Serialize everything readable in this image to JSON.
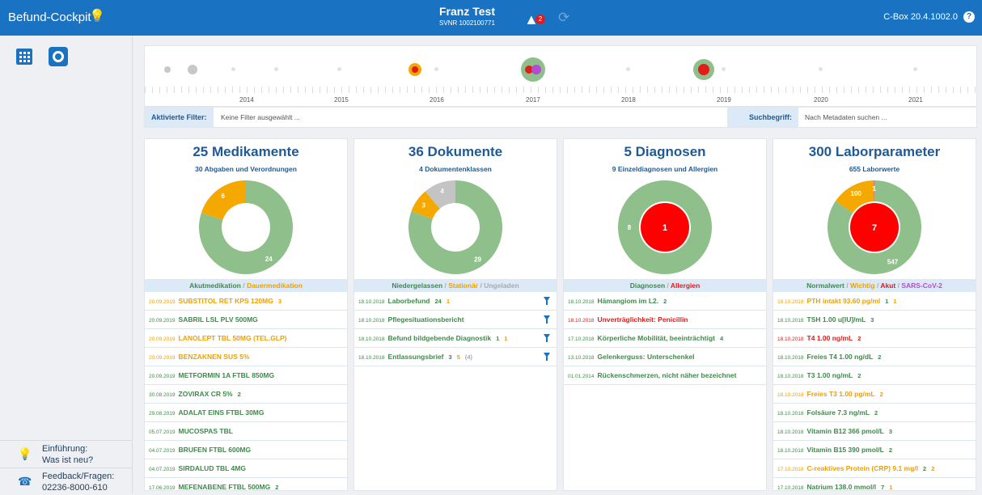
{
  "header": {
    "app_title": "Befund-Cockpit",
    "patient_name": "Franz Test",
    "patient_svnr": "SVNR 1002100771",
    "warning_count": "2",
    "version": "C-Box 20.4.1002.0",
    "help_label": "?"
  },
  "sidebar": {
    "intro_line1": "Einführung:",
    "intro_line2": "Was ist neu?",
    "feedback_line1": "Feedback/Fragen:",
    "feedback_line2": "02236-8000-610"
  },
  "timeline": {
    "years": [
      "2014",
      "2015",
      "2016",
      "2017",
      "2018",
      "2019",
      "2020",
      "2021"
    ]
  },
  "filters": {
    "active_label": "Aktivierte Filter:",
    "active_value": "Keine Filter ausgewählt ...",
    "search_label": "Suchbegriff:",
    "search_placeholder": "Nach Metadaten suchen ..."
  },
  "panels": [
    {
      "title": "25 Medikamente",
      "subtitle": "30 Abgaben und Verordnungen",
      "legend": [
        {
          "t": "Akutmedikation",
          "c": "g"
        },
        {
          "t": "Dauermedikation",
          "c": "o"
        }
      ],
      "donut": {
        "slices": [
          {
            "v": 24,
            "color": "#8fbf8a",
            "label": "24"
          },
          {
            "v": 6,
            "color": "#f5a800",
            "label": "6"
          }
        ]
      },
      "rows": [
        {
          "d": "20.09.2019",
          "t": "SUBSTITOL RET KPS 120MG",
          "c": "o",
          "n": [
            {
              "v": "3",
              "c": "o"
            }
          ]
        },
        {
          "d": "20.09.2019",
          "t": "SABRIL LSL PLV 500MG",
          "c": "g",
          "n": []
        },
        {
          "d": "20.09.2019",
          "t": "LANOLEPT TBL 50MG (TEL.GLP)",
          "c": "o",
          "n": []
        },
        {
          "d": "20.09.2019",
          "t": "BENZAKNEN SUS 5%",
          "c": "o",
          "n": []
        },
        {
          "d": "20.09.2019",
          "t": "METFORMIN 1A FTBL 850MG",
          "c": "g",
          "n": []
        },
        {
          "d": "30.08.2019",
          "t": "ZOVIRAX CR 5%",
          "c": "g",
          "n": [
            {
              "v": "2",
              "c": "g"
            }
          ]
        },
        {
          "d": "29.08.2019",
          "t": "ADALAT EINS FTBL 30MG",
          "c": "g",
          "n": []
        },
        {
          "d": "05.07.2019",
          "t": "MUCOSPAS TBL",
          "c": "g",
          "n": []
        },
        {
          "d": "04.07.2019",
          "t": "BRUFEN FTBL 600MG",
          "c": "g",
          "n": []
        },
        {
          "d": "04.07.2019",
          "t": "SIRDALUD TBL 4MG",
          "c": "g",
          "n": []
        },
        {
          "d": "17.06.2019",
          "t": "MEFENABENE FTBL 500MG",
          "c": "g",
          "n": [
            {
              "v": "2",
              "c": "g"
            }
          ]
        }
      ]
    },
    {
      "title": "36 Dokumente",
      "subtitle": "4 Dokumentenklassen",
      "legend": [
        {
          "t": "Niedergelassen",
          "c": "g"
        },
        {
          "t": "Stationär",
          "c": "o"
        },
        {
          "t": "Ungeladen",
          "c": "gr"
        }
      ],
      "donut": {
        "slices": [
          {
            "v": 29,
            "color": "#8fbf8a",
            "label": "29"
          },
          {
            "v": 3,
            "color": "#f5a800",
            "label": "3"
          },
          {
            "v": 4,
            "color": "#c4c4c4",
            "label": "4"
          }
        ]
      },
      "rows": [
        {
          "d": "18.10.2018",
          "t": "Laborbefund",
          "c": "g",
          "n": [
            {
              "v": "24",
              "c": "g"
            },
            {
              "v": "1",
              "c": "o"
            }
          ],
          "filter": true
        },
        {
          "d": "18.10.2018",
          "t": "Pflegesituationsbericht",
          "c": "g",
          "n": [],
          "filter": true
        },
        {
          "d": "18.10.2018",
          "t": "Befund bildgebende Diagnostik",
          "c": "g",
          "n": [
            {
              "v": "1",
              "c": "g"
            },
            {
              "v": "1",
              "c": "o"
            }
          ],
          "filter": true
        },
        {
          "d": "18.10.2018",
          "t": "Entlassungsbrief",
          "c": "g",
          "n": [
            {
              "v": "3",
              "c": "g"
            },
            {
              "v": "5",
              "c": "o"
            },
            {
              "v": "(4)",
              "c": "gr"
            }
          ],
          "filter": true
        }
      ]
    },
    {
      "title": "5 Diagnosen",
      "subtitle": "9 Einzeldiagnosen und Allergien",
      "legend": [
        {
          "t": "Diagnosen",
          "c": "g"
        },
        {
          "t": "Allergien",
          "c": "r"
        }
      ],
      "donut": {
        "slices": [
          {
            "v": 8,
            "color": "#8fbf8a",
            "label": "8"
          }
        ],
        "center": {
          "value": "1",
          "color": "#ff0000"
        }
      },
      "rows": [
        {
          "d": "18.10.2018",
          "t": "Hämangiom im L2.",
          "c": "g",
          "n": [
            {
              "v": "2",
              "c": "g"
            }
          ]
        },
        {
          "d": "18.10.2018",
          "t": "Unverträglichkeit: Penicillin",
          "c": "r",
          "n": []
        },
        {
          "d": "17.10.2018",
          "t": "Körperliche Mobilität, beeinträchtigt",
          "c": "g",
          "n": [
            {
              "v": "4",
              "c": "g"
            }
          ]
        },
        {
          "d": "13.10.2018",
          "t": "Gelenkerguss: Unterschenkel",
          "c": "g",
          "n": []
        },
        {
          "d": "01.01.2014",
          "t": "Rückenschmerzen, nicht näher bezeichnet",
          "c": "g",
          "n": []
        }
      ]
    },
    {
      "title": "300 Laborparameter",
      "subtitle": "655 Laborwerte",
      "legend": [
        {
          "t": "Normalwert",
          "c": "g"
        },
        {
          "t": "Wichtig",
          "c": "o"
        },
        {
          "t": "Akut",
          "c": "r"
        },
        {
          "t": "SARS-CoV-2",
          "c": "p"
        }
      ],
      "donut": {
        "slices": [
          {
            "v": 547,
            "color": "#8fbf8a",
            "label": "547"
          },
          {
            "v": 100,
            "color": "#f5a800",
            "label": "100"
          },
          {
            "v": 1,
            "color": "#b24dd1",
            "label": "1"
          }
        ],
        "center": {
          "value": "7",
          "color": "#ff0000"
        }
      },
      "rows": [
        {
          "d": "18.10.2018",
          "t": "PTH intakt 93.60 pg/ml",
          "c": "o",
          "n": [
            {
              "v": "1",
              "c": "g"
            },
            {
              "v": "1",
              "c": "o"
            }
          ]
        },
        {
          "d": "18.10.2018",
          "t": "TSH 1.00 u[IU]/mL",
          "c": "g",
          "n": [
            {
              "v": "3",
              "c": "g"
            }
          ]
        },
        {
          "d": "18.10.2018",
          "t": "T4 1.00 ng/mL",
          "c": "r",
          "n": [
            {
              "v": "2",
              "c": "r"
            }
          ]
        },
        {
          "d": "18.10.2018",
          "t": "Freies T4 1.00 ng/dL",
          "c": "g",
          "n": [
            {
              "v": "2",
              "c": "g"
            }
          ]
        },
        {
          "d": "18.10.2018",
          "t": "T3 1.00 ng/mL",
          "c": "g",
          "n": [
            {
              "v": "2",
              "c": "g"
            }
          ]
        },
        {
          "d": "18.10.2018",
          "t": "Freies T3 1.00 pg/mL",
          "c": "o",
          "n": [
            {
              "v": "2",
              "c": "o"
            }
          ]
        },
        {
          "d": "18.10.2018",
          "t": "Folsäure 7.3 ng/mL",
          "c": "g",
          "n": [
            {
              "v": "2",
              "c": "g"
            }
          ]
        },
        {
          "d": "18.10.2018",
          "t": "Vitamin B12 366 pmol/L",
          "c": "g",
          "n": [
            {
              "v": "3",
              "c": "g"
            }
          ]
        },
        {
          "d": "18.10.2018",
          "t": "Vitamin B15 390 pmol/L",
          "c": "g",
          "n": [
            {
              "v": "2",
              "c": "g"
            }
          ]
        },
        {
          "d": "17.10.2018",
          "t": "C-reaktives Protein (CRP) 9.1 mg/l",
          "c": "o",
          "n": [
            {
              "v": "2",
              "c": "g"
            },
            {
              "v": "2",
              "c": "o"
            }
          ]
        },
        {
          "d": "17.10.2018",
          "t": "Natrium 138.0 mmol/l",
          "c": "g",
          "n": [
            {
              "v": "7",
              "c": "g"
            },
            {
              "v": "1",
              "c": "o"
            }
          ]
        }
      ]
    }
  ]
}
